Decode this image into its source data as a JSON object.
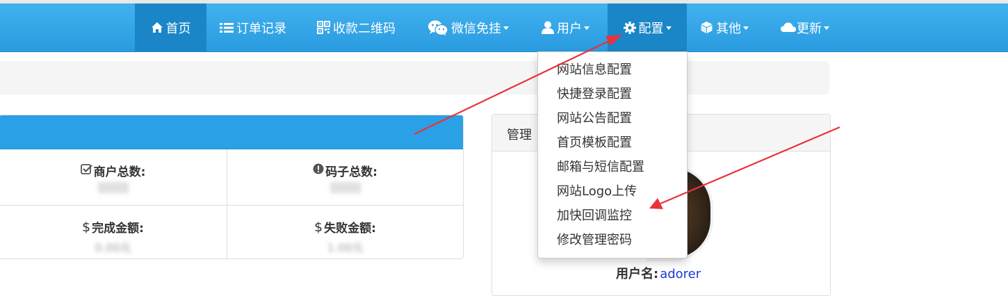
{
  "nav": {
    "items": [
      {
        "label": "首页",
        "icon": "home-icon",
        "active": true
      },
      {
        "label": "订单记录",
        "icon": "list-icon"
      },
      {
        "label": "收款二维码",
        "icon": "qrcode-icon"
      },
      {
        "label": "微信免挂",
        "icon": "wechat-icon",
        "dropdown": true
      },
      {
        "label": "用户",
        "icon": "user-icon",
        "dropdown": true
      },
      {
        "label": "配置",
        "icon": "gear-icon",
        "dropdown": true,
        "open": true
      },
      {
        "label": "其他",
        "icon": "cube-icon",
        "dropdown": true
      },
      {
        "label": "更新",
        "icon": "cloud-icon",
        "dropdown": true
      }
    ]
  },
  "config_menu": {
    "items": [
      "网站信息配置",
      "快捷登录配置",
      "网站公告配置",
      "首页模板配置",
      "邮箱与短信配置",
      "网站Logo上传",
      "加快回调监控",
      "修改管理密码"
    ]
  },
  "stats": {
    "merchant_total_label": "商户总数:",
    "code_total_label": "码子总数:",
    "completed_amount_label": "完成金额:",
    "failed_amount_label": "失败金额:",
    "completed_amount_value": "0.00元",
    "failed_amount_value": "1.00元"
  },
  "admin_panel": {
    "title": "管理",
    "username_label": "用户名:",
    "username_value": "adorer"
  },
  "colors": {
    "navbar": "#2a9be0",
    "navbar_active": "#1a86c7",
    "panel_header": "#2aa0e6",
    "annotation_arrow": "#e8323c",
    "link": "#1a37d8"
  }
}
